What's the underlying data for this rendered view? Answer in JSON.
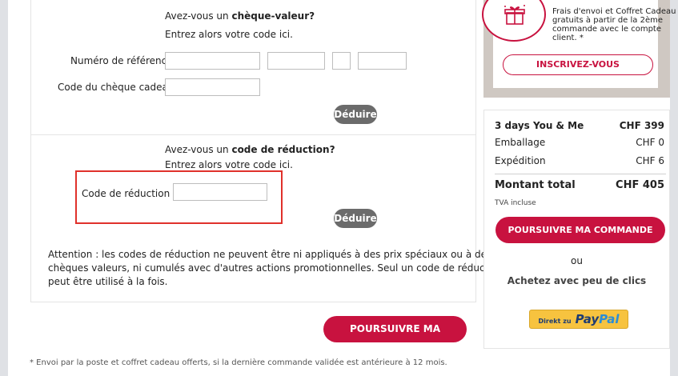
{
  "voucher": {
    "question_prefix": "Avez-vous un",
    "question_bold": "chèque-valeur?",
    "instruction": "Entrez alors votre code ici.",
    "reference_label": "Numéro de référence",
    "gift_code_label": "Code du chèque cadeau",
    "deduct_label": "Déduire"
  },
  "discount": {
    "question_prefix": "Avez-vous un",
    "question_bold": "code de réduction?",
    "instruction": "Entrez alors votre code ici.",
    "code_label": "Code de réduction",
    "deduct_label": "Déduire",
    "warning": [
      "Attention : les codes de réduction ne peuvent être ni appliqués à des prix spéciaux ou à des",
      "chèques valeurs, ni cumulés avec d'autres actions promotionnelles. Seul un code de réduction",
      "peut être utilisé à la fois."
    ]
  },
  "continue_label": "POURSUIVRE MA COMMANDE",
  "footnote": "* Envoi par la poste et coffret cadeau offerts, si la dernière commande validée est antérieure à 12 mois.",
  "promo": {
    "text": [
      "Frais d'envoi et Coffret Cadeau",
      "gratuits à partir de la 2ème",
      "commande avec le compte",
      "client. *"
    ],
    "signup_label": "INSCRIVEZ-VOUS"
  },
  "summary": {
    "product_name": "3 days You & Me",
    "product_price": "CHF 399",
    "packaging_label": "Emballage",
    "packaging_price": "CHF 0",
    "shipping_label": "Expédition",
    "shipping_price": "CHF 6",
    "total_label": "Montant total",
    "total_price": "CHF 405",
    "vat_note": "TVA incluse",
    "continue_label": "POURSUIVRE MA COMMANDE",
    "or_label": "ou",
    "quick_checkout": "Achetez avec peu de clics",
    "paypal_prefix": "Direkt zu",
    "paypal_brand_pay": "Pay",
    "paypal_brand_pal": "Pal"
  },
  "colors": {
    "accent": "#c8123f",
    "grey_button": "#6b6b6b",
    "paypal_yellow": "#f7c33f"
  }
}
